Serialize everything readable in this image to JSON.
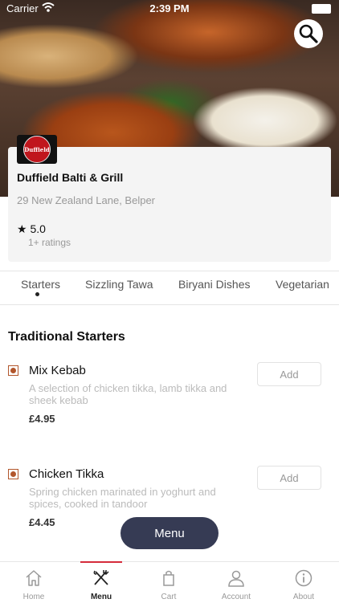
{
  "status_bar": {
    "carrier": "Carrier",
    "time": "2:39 PM"
  },
  "restaurant": {
    "logo_text": "Duffield",
    "name": "Duffield Balti & Grill",
    "address": "29 New Zealand Lane, Belper",
    "rating": "5.0",
    "ratings_count": "1+ ratings"
  },
  "category_tabs": [
    {
      "label": "Starters",
      "active": true
    },
    {
      "label": "Sizzling Tawa"
    },
    {
      "label": "Biryani Dishes"
    },
    {
      "label": "Vegetarian"
    }
  ],
  "section": {
    "title": "Traditional Starters"
  },
  "items": [
    {
      "name": "Mix Kebab",
      "description": "A selection of chicken tikka, lamb tikka and sheek kebab",
      "price": "£4.95",
      "add_label": "Add"
    },
    {
      "name": "Chicken Tikka",
      "description": "Spring chicken marinated in yoghurt and spices, cooked in tandoor",
      "price": "£4.45",
      "add_label": "Add"
    }
  ],
  "menu_button": "Menu",
  "tab_bar": [
    {
      "label": "Home",
      "icon": "home-icon"
    },
    {
      "label": "Menu",
      "icon": "fork-knife-icon",
      "active": true
    },
    {
      "label": "Cart",
      "icon": "bag-icon"
    },
    {
      "label": "Account",
      "icon": "person-icon"
    },
    {
      "label": "About",
      "icon": "info-icon"
    }
  ],
  "colors": {
    "accent": "#d52b3b",
    "menu_button_bg": "#363b54",
    "veg_icon": "#b2562c"
  }
}
